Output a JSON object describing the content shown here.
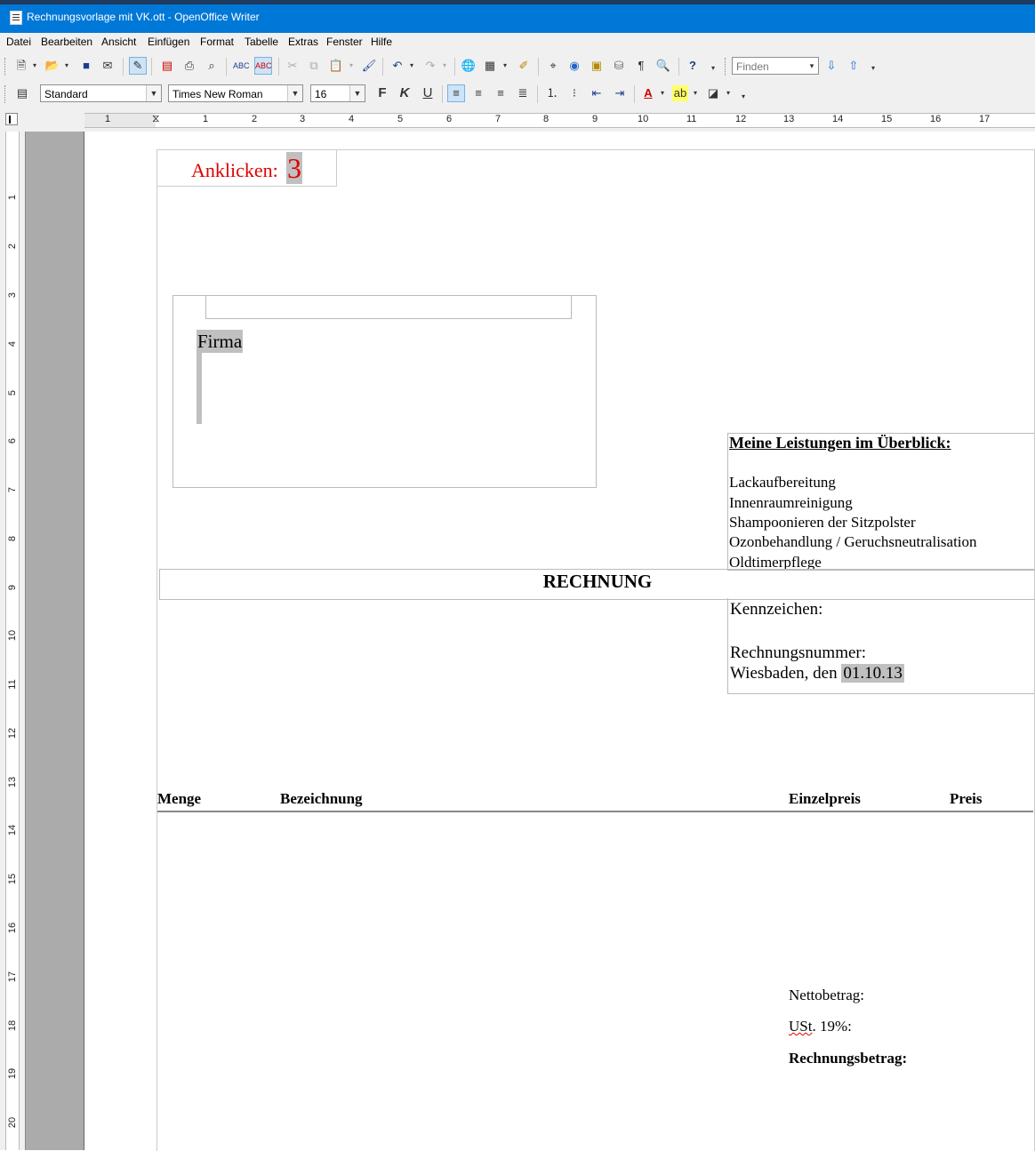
{
  "window": {
    "title": "Rechnungsvorlage mit VK.ott - OpenOffice Writer"
  },
  "menu": [
    "Datei",
    "Bearbeiten",
    "Ansicht",
    "Einfügen",
    "Format",
    "Tabelle",
    "Extras",
    "Fenster",
    "Hilfe"
  ],
  "toolbar": {
    "find_placeholder": "Finden",
    "paragraph_style": "Standard",
    "font_name": "Times New Roman",
    "font_size": "16",
    "bold_label": "F",
    "italic_label": "K",
    "underline_label": "U"
  },
  "ruler": {
    "h_labels": [
      "1",
      "1",
      "2",
      "3",
      "4",
      "5",
      "6",
      "7",
      "8",
      "9",
      "10",
      "11",
      "12",
      "13",
      "14",
      "15",
      "16",
      "17"
    ],
    "v_labels": [
      "1",
      "2",
      "3",
      "4",
      "5",
      "6",
      "7",
      "8",
      "9",
      "10",
      "11",
      "12",
      "13",
      "14",
      "15",
      "16",
      "17",
      "18",
      "19",
      "20"
    ]
  },
  "document": {
    "anklicken_label": "Anklicken:",
    "anklicken_value": "3",
    "address_firma": "Firma",
    "leistungen_title": "Meine Leistungen im Überblick:",
    "leistungen": [
      "Lackaufbereitung",
      "Innenraumreinigung",
      "Shampoonieren der Sitzpolster",
      "Ozonbehandlung / Geruchsneutralisation",
      "Oldtimerpflege"
    ],
    "rechnung_title": "RECHNUNG",
    "kennzeichen_label": "Kennzeichen:",
    "rechnungsnummer_label": "Rechnungsnummer:",
    "ort_prefix": "Wiesbaden, den",
    "datum": "01.10.13",
    "columns": [
      "Menge",
      "Bezeichnung",
      "Einzelpreis",
      "Preis"
    ],
    "netto_label": "Nettobetrag:",
    "ust_abbr": "USt",
    "ust_rest": ". 19%:",
    "rechnungsbetrag_label": "Rechnungsbetrag:"
  }
}
